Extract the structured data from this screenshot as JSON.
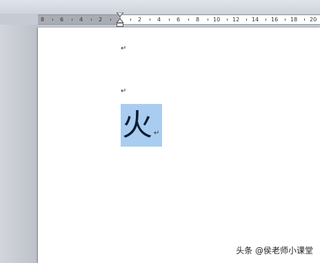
{
  "ruler": {
    "labels": [
      "8",
      "6",
      "4",
      "2",
      "2",
      "4",
      "6",
      "8",
      "10",
      "12",
      "14",
      "16",
      "18",
      "20"
    ]
  },
  "document": {
    "paragraph_mark": "↵",
    "selected_character": "火",
    "selection_color": "#a9cdf0"
  },
  "watermark": {
    "text": "头条 @侯老师小课堂"
  }
}
